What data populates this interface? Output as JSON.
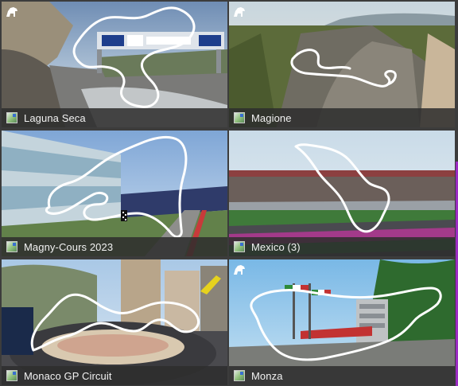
{
  "tracks": [
    {
      "name": "Laguna Seca",
      "badge": true
    },
    {
      "name": "Magione",
      "badge": true
    },
    {
      "name": "Magny-Cours 2023",
      "badge": false
    },
    {
      "name": "Mexico (3)",
      "badge": false
    },
    {
      "name": "Monaco GP Circuit",
      "badge": false
    },
    {
      "name": "Monza",
      "badge": true
    }
  ],
  "icons": {
    "preview": "image-thumbnail-icon",
    "badge": "ac-horse-logo-icon"
  },
  "colors": {
    "accent_scrollbar": "#9b2cc2",
    "caption_bar": "#2d2d2d",
    "background": "#3c3c3c"
  }
}
